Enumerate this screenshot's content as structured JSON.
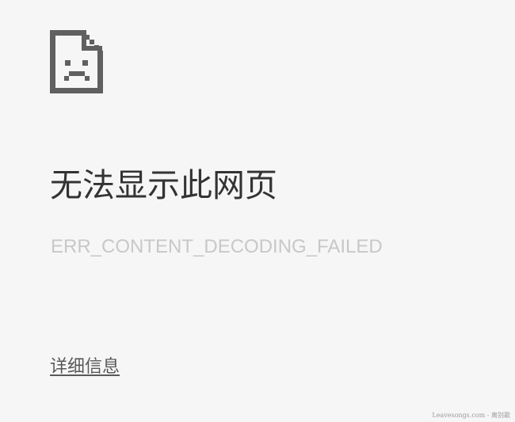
{
  "error_page": {
    "icon": "sad-page-icon",
    "title": "无法显示此网页",
    "error_code": "ERR_CONTENT_DECODING_FAILED",
    "details_link": "详细信息"
  },
  "watermark": {
    "text": "Leavesongs.com - 离别歌"
  },
  "colors": {
    "background": "#f6f6f6",
    "title": "#333333",
    "error_code": "#c8c8c8",
    "link": "#595959",
    "icon": "#606060"
  }
}
